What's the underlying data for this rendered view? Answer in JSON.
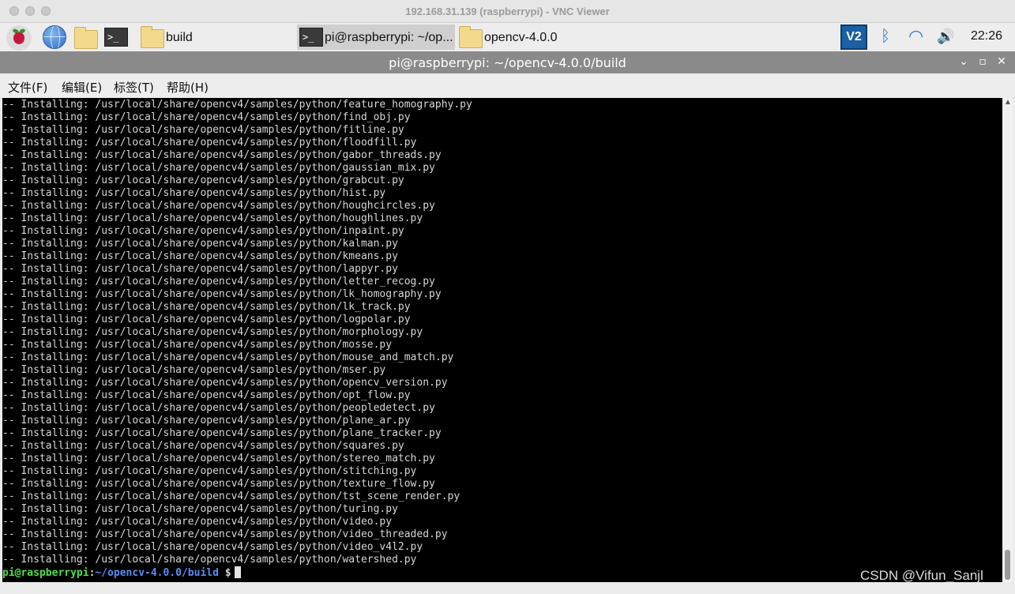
{
  "mac_window": {
    "title": "192.168.31.139 (raspberrypi) - VNC Viewer"
  },
  "taskbar": {
    "launchers": [
      {
        "icon": "raspberry-pi-menu-icon"
      },
      {
        "icon": "web-browser-globe-icon"
      },
      {
        "icon": "file-manager-folder-icon"
      },
      {
        "icon": "terminal-icon",
        "glyph": ">_"
      }
    ],
    "tasks": [
      {
        "icon": "folder-icon",
        "label": "build"
      },
      {
        "icon": "terminal-icon",
        "glyph": ">_",
        "label": "pi@raspberrypi: ~/op..."
      },
      {
        "icon": "folder-icon",
        "label": "opencv-4.0.0"
      }
    ],
    "tray": {
      "vnc_label": "V2",
      "bluetooth_glyph": "ᛒ",
      "wifi_glyph": "◠",
      "volume_glyph": "🔊",
      "clock": "22:26"
    }
  },
  "terminal": {
    "title": "pi@raspberrypi: ~/opencv-4.0.0/build",
    "controls": {
      "minimize": "⌄",
      "maximize": "▫",
      "close": "✕"
    },
    "menu": [
      "文件(F)",
      "编辑(E)",
      "标签(T)",
      "帮助(H)"
    ],
    "lines": [
      "-- Installing: /usr/local/share/opencv4/samples/python/feature_homography.py",
      "-- Installing: /usr/local/share/opencv4/samples/python/find_obj.py",
      "-- Installing: /usr/local/share/opencv4/samples/python/fitline.py",
      "-- Installing: /usr/local/share/opencv4/samples/python/floodfill.py",
      "-- Installing: /usr/local/share/opencv4/samples/python/gabor_threads.py",
      "-- Installing: /usr/local/share/opencv4/samples/python/gaussian_mix.py",
      "-- Installing: /usr/local/share/opencv4/samples/python/grabcut.py",
      "-- Installing: /usr/local/share/opencv4/samples/python/hist.py",
      "-- Installing: /usr/local/share/opencv4/samples/python/houghcircles.py",
      "-- Installing: /usr/local/share/opencv4/samples/python/houghlines.py",
      "-- Installing: /usr/local/share/opencv4/samples/python/inpaint.py",
      "-- Installing: /usr/local/share/opencv4/samples/python/kalman.py",
      "-- Installing: /usr/local/share/opencv4/samples/python/kmeans.py",
      "-- Installing: /usr/local/share/opencv4/samples/python/lappyr.py",
      "-- Installing: /usr/local/share/opencv4/samples/python/letter_recog.py",
      "-- Installing: /usr/local/share/opencv4/samples/python/lk_homography.py",
      "-- Installing: /usr/local/share/opencv4/samples/python/lk_track.py",
      "-- Installing: /usr/local/share/opencv4/samples/python/logpolar.py",
      "-- Installing: /usr/local/share/opencv4/samples/python/morphology.py",
      "-- Installing: /usr/local/share/opencv4/samples/python/mosse.py",
      "-- Installing: /usr/local/share/opencv4/samples/python/mouse_and_match.py",
      "-- Installing: /usr/local/share/opencv4/samples/python/mser.py",
      "-- Installing: /usr/local/share/opencv4/samples/python/opencv_version.py",
      "-- Installing: /usr/local/share/opencv4/samples/python/opt_flow.py",
      "-- Installing: /usr/local/share/opencv4/samples/python/peopledetect.py",
      "-- Installing: /usr/local/share/opencv4/samples/python/plane_ar.py",
      "-- Installing: /usr/local/share/opencv4/samples/python/plane_tracker.py",
      "-- Installing: /usr/local/share/opencv4/samples/python/squares.py",
      "-- Installing: /usr/local/share/opencv4/samples/python/stereo_match.py",
      "-- Installing: /usr/local/share/opencv4/samples/python/stitching.py",
      "-- Installing: /usr/local/share/opencv4/samples/python/texture_flow.py",
      "-- Installing: /usr/local/share/opencv4/samples/python/tst_scene_render.py",
      "-- Installing: /usr/local/share/opencv4/samples/python/turing.py",
      "-- Installing: /usr/local/share/opencv4/samples/python/video.py",
      "-- Installing: /usr/local/share/opencv4/samples/python/video_threaded.py",
      "-- Installing: /usr/local/share/opencv4/samples/python/video_v4l2.py",
      "-- Installing: /usr/local/share/opencv4/samples/python/watershed.py"
    ],
    "prompt": {
      "user_host": "pi@raspberrypi",
      "colon": ":",
      "path": "~/opencv-4.0.0/build",
      "symbol": "$"
    }
  },
  "watermark": "CSDN @Vifun_Sanjl",
  "colors": {
    "terminal_bg": "#000000",
    "terminal_text": "#d7d7d7",
    "prompt_user": "#4ee04e",
    "prompt_path": "#5c8cf2",
    "window_title_bg": "#8a8a8a",
    "vnc_blue": "#1b5fa4"
  }
}
